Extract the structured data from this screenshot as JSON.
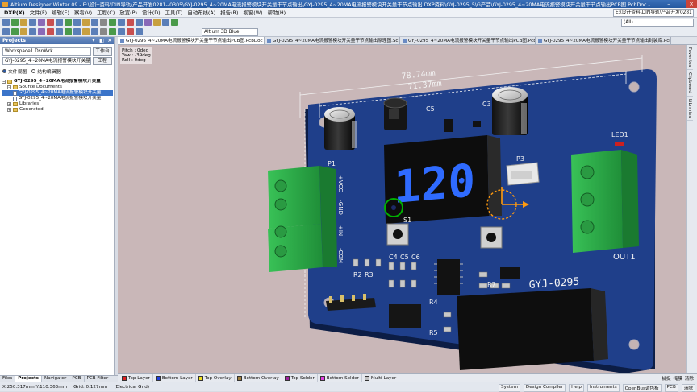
{
  "window": {
    "title": "Altium Designer Winter 09 - E:\\设计资料\\DIN导轨\\产品开发0281--0305\\GYJ-0295_4~20MA电流报警模块开关量干节点输出\\GYJ-0295_4~20MA电流报警模块开关量干节点输出.DXP资料\\GYJ-0295_5\\G产品\\GYJ-0295_4~20MA电流报警模块开关量干节点输出PCB图.PcbDoc - ..."
  },
  "menubar": {
    "items": [
      "DXP(X)",
      "文件(F)",
      "编辑(E)",
      "察看(V)",
      "工程(C)",
      "放置(P)",
      "设计(D)",
      "工具(T)",
      "自动布线(A)",
      "报告(R)",
      "视窗(W)",
      "帮助(H)"
    ],
    "path": "E:\\设计资料\\DIN导轨\\产品开发0281"
  },
  "toolbar": {
    "select_value": "(All)",
    "view_select": "Altium 3D Blue"
  },
  "projects_panel": {
    "title": "Projects",
    "workspace": "Workspace1.DsnWrk",
    "workspace_btn": "工作台",
    "project": "GYJ-0295_4~20MA电流报警模块开关量干节点输",
    "project_btn": "工程",
    "view_file": "文件视图",
    "view_struct": "结构编辑器",
    "tree": [
      {
        "label": "GYJ-0295_4~20MA电流报警模块开关量",
        "kind": "project",
        "indent": 0
      },
      {
        "label": "Source Documents",
        "kind": "folder",
        "indent": 1
      },
      {
        "label": "GYJ-0295_4~20MA电流报警模块开关量",
        "kind": "doc",
        "indent": 2,
        "selected": true
      },
      {
        "label": "GYJ-0295_4~20MA电流报警模块开关量",
        "kind": "doc",
        "indent": 2
      },
      {
        "label": "Libraries",
        "kind": "folder",
        "indent": 1
      },
      {
        "label": "Generated",
        "kind": "folder",
        "indent": 1
      }
    ],
    "tabs": [
      "Files",
      "Projects",
      "Navigator",
      "PCB",
      "PCB Filter"
    ]
  },
  "doc_tabs": [
    {
      "label": "GYJ-0295_4~20MA电流报警模块开关量干节点输出PCB图.PcbDoc",
      "active": true
    },
    {
      "label": "GYJ-0295_4~20MA电流报警模块开关量干节点输出原理图.SchDoc"
    },
    {
      "label": "GYJ-0295_4~20MA电流报警模块开关量干节点输出PCB图.PcbLib"
    },
    {
      "label": "GYJ-0295_4~20MA电流报警模块开关量干节点输出封装库.PcbLib"
    }
  ],
  "hud": {
    "pitch": "Pitch : 0deg",
    "yaw": "Yaw : -39deg",
    "roll": "Roll : 0deg"
  },
  "pcb": {
    "dim_outer": "78.74mm",
    "dim_inner": "71.37mm",
    "display_digits": "120",
    "silk_labels": {
      "p1": "P1",
      "p3": "P3",
      "s1": "S1",
      "led1": "LED1",
      "out1": "OUT1",
      "r2": "R2",
      "r3": "R3",
      "c4": "C4",
      "c5": "C5",
      "c6": "C6",
      "r4": "R4",
      "r5": "R5",
      "r7": "R7",
      "c3": "C3",
      "c5b": "C5",
      "brand": "GYJ-0295",
      "vcc": "+VCC",
      "gnd": "-GND",
      "in": "+IN",
      "com": "-COM"
    },
    "colors": {
      "board": "#1f3f8a",
      "background": "#c9b7b8",
      "terminal": "#2fb24a",
      "display_digit": "#2f6bff"
    }
  },
  "layers": [
    {
      "name": "Top Layer",
      "color": "#e02020"
    },
    {
      "name": "Bottom Layer",
      "color": "#2040e0"
    },
    {
      "name": "Top Overlay",
      "color": "#f0e020"
    },
    {
      "name": "Bottom Overlay",
      "color": "#a08040"
    },
    {
      "name": "Top Solder",
      "color": "#a020a0"
    },
    {
      "name": "Bottom Solder",
      "color": "#e040e0"
    },
    {
      "name": "Multi-Layer",
      "color": "#c0c0c0"
    }
  ],
  "layer_tools": [
    "捕捉",
    "掩膜",
    "清除"
  ],
  "status": {
    "coords": "X:250.317mm Y:110.363mm",
    "grid": "Grid: 0.127mm",
    "grid_mode": "(Electrical Grid)",
    "right": [
      "System",
      "Design Compiler",
      "Help",
      "Instruments",
      "OpenBus调色板",
      "PCB",
      "清除"
    ]
  },
  "right_panel": [
    "Favorites",
    "Clipboard",
    "Libraries"
  ]
}
